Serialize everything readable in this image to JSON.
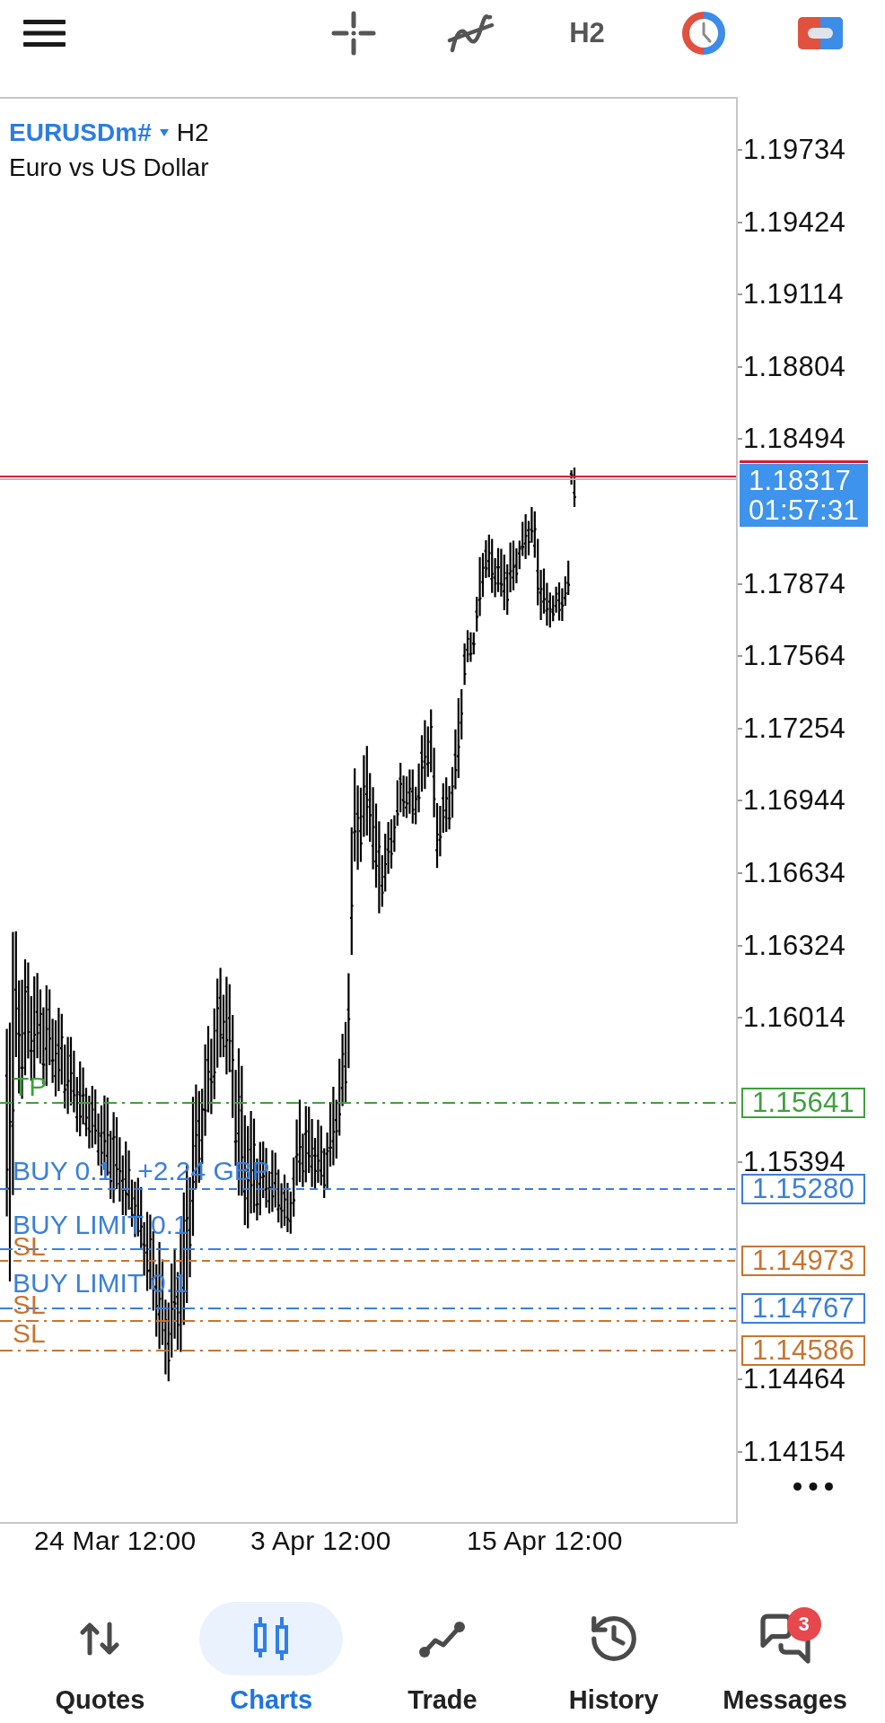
{
  "toolbar": {
    "timeframe": "H2"
  },
  "chart": {
    "symbol": "EURUSDm#",
    "timeframe": "H2",
    "description": "Euro vs US Dollar",
    "price_axis": [
      "1.19734",
      "1.19424",
      "1.19114",
      "1.18804",
      "1.18494",
      "1.17874",
      "1.17564",
      "1.17254",
      "1.16944",
      "1.16634",
      "1.16324",
      "1.16014",
      "1.15394",
      "1.14464",
      "1.14154"
    ],
    "current_price": {
      "price": "1.18317",
      "countdown": "01:57:31"
    },
    "orders": [
      {
        "label": "TP",
        "price": "1.15641",
        "color": "#3f9f3f",
        "dash_dot": true
      },
      {
        "label": "BUY 0.1",
        "profit": "+2.24 GBP",
        "price": "1.15280",
        "color": "#3b7fd8",
        "dash_dot": false
      },
      {
        "label": "BUY LIMIT 0.1",
        "color": "#3b7fd8",
        "dash_dot": true
      },
      {
        "label": "SL",
        "price": "1.14973",
        "color": "#c8742f",
        "dash_dot": false
      },
      {
        "label": "BUY LIMIT 0.1",
        "price": "1.14767",
        "color": "#3b7fd8",
        "dash_dot": true
      },
      {
        "label": "SL",
        "color": "#c8742f",
        "dash_dot": true
      },
      {
        "label": "SL",
        "price": "1.14586",
        "color": "#c8742f",
        "dash_dot": true
      }
    ],
    "time_axis": [
      "24 Mar 12:00",
      "3 Apr 12:00",
      "15 Apr 12:00"
    ]
  },
  "nav": [
    {
      "label": "Quotes",
      "selected": false
    },
    {
      "label": "Charts",
      "selected": true
    },
    {
      "label": "Trade",
      "selected": false
    },
    {
      "label": "History",
      "selected": false
    },
    {
      "label": "Messages",
      "selected": false,
      "badge": "3"
    }
  ]
}
